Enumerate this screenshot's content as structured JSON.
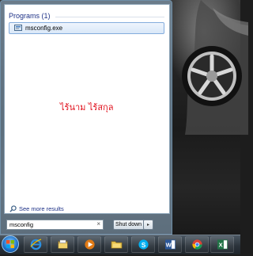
{
  "start_menu": {
    "section_header": "Programs (1)",
    "result_item": "msconfig.exe",
    "overlay_text": "ไร้นาม ไร้สกุล",
    "see_more": "See more results",
    "search_value": "msconfig",
    "search_clear": "×",
    "shutdown_label": "Shut down",
    "shutdown_arrow": "▸"
  },
  "taskbar": {
    "pinned": [
      {
        "icon": "internet-explorer-icon"
      },
      {
        "icon": "file-explorer-icon"
      },
      {
        "icon": "media-player-icon"
      },
      {
        "icon": "folder-icon"
      },
      {
        "icon": "skype-icon"
      },
      {
        "icon": "word-icon"
      },
      {
        "icon": "chrome-icon"
      },
      {
        "icon": "excel-icon"
      }
    ]
  },
  "colors": {
    "accent_text": "#1e3287",
    "overlay_red": "#e0101c",
    "selection_border": "#84acdd"
  }
}
